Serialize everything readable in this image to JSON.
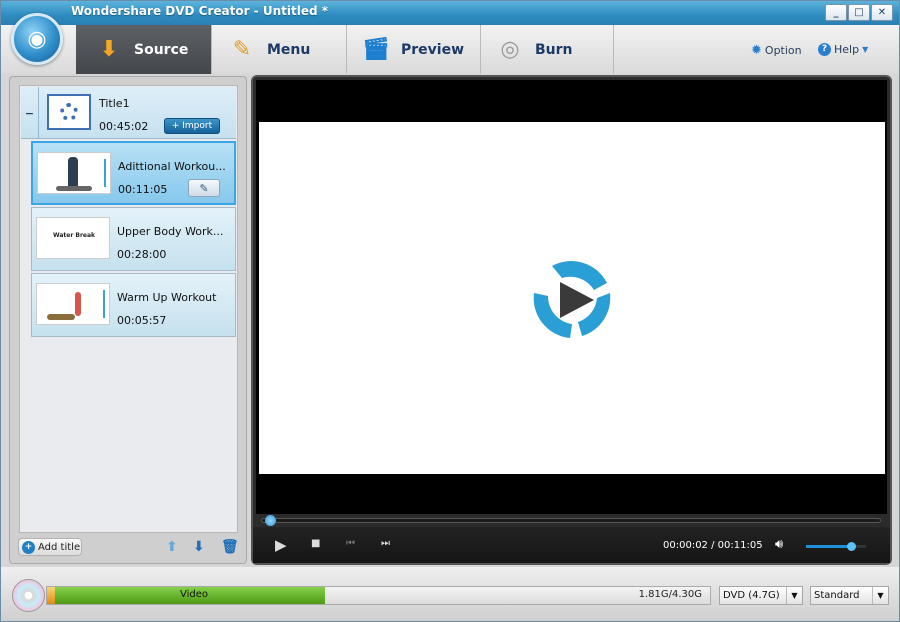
{
  "window": {
    "title": "Wondershare DVD Creator - Untitled *",
    "controls": {
      "minimize": "_",
      "maximize": "□",
      "close": "✕"
    }
  },
  "toolbar": {
    "tabs": [
      {
        "label": "Source",
        "icon": "download-icon",
        "active": true
      },
      {
        "label": "Menu",
        "icon": "pencil-ruler-icon",
        "active": false
      },
      {
        "label": "Preview",
        "icon": "clapperboard-icon",
        "active": false
      },
      {
        "label": "Burn",
        "icon": "disc-flame-icon",
        "active": false
      }
    ],
    "option_label": "Option",
    "help_label": "Help"
  },
  "source_panel": {
    "title_group": {
      "name": "Title1",
      "duration": "00:45:02",
      "import_label": "+ Import",
      "collapse_symbol": "−"
    },
    "clips": [
      {
        "name": "Adittional Workou...",
        "duration": "00:11:05",
        "selected": true,
        "thumb_text": ""
      },
      {
        "name": "Upper Body Work...",
        "duration": "00:28:00",
        "selected": false,
        "thumb_text": "Water Break"
      },
      {
        "name": "Warm Up Workout",
        "duration": "00:05:57",
        "selected": false,
        "thumb_text": ""
      }
    ],
    "add_title_label": "Add title"
  },
  "player": {
    "current_time": "00:00:02",
    "separator": "/",
    "total_time": "00:11:05",
    "seek_progress": 0.003,
    "volume": 0.75
  },
  "status": {
    "capacity_label": "Video",
    "capacity_used": "1.81G/4.30G",
    "capacity_fraction": 0.42,
    "disc_type": "DVD (4.7G)",
    "quality": "Standard"
  },
  "colors": {
    "accent": "#2e8bbf",
    "capacity_green": "#5aae1e",
    "logo_blue": "#2a9fd6"
  }
}
